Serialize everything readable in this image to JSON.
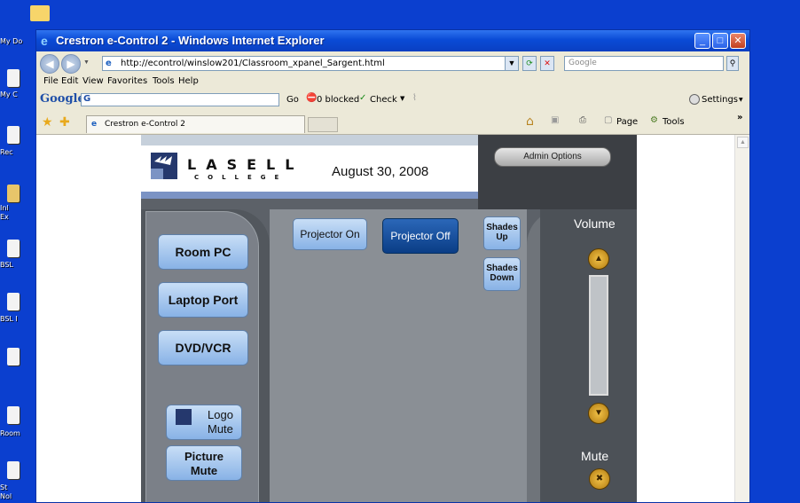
{
  "desktop": {
    "icons": [
      {
        "label": "My Do"
      },
      {
        "label": "My C"
      },
      {
        "label": "Rec"
      },
      {
        "label": "Inl"
      },
      {
        "label": "Ex"
      },
      {
        "label": "BSL"
      },
      {
        "label": "BSL I"
      },
      {
        "label": "Room"
      },
      {
        "label": "St"
      },
      {
        "label": "Nol"
      }
    ]
  },
  "window": {
    "title": "Crestron e-Control 2 - Windows Internet Explorer",
    "minimize_icon": "minimize-icon",
    "maximize_icon": "maximize-icon",
    "close_icon": "close-icon"
  },
  "address_bar": {
    "url": "http://econtrol/winslow201/Classroom_xpanel_Sargent.html",
    "search_placeholder": "Google"
  },
  "menu": {
    "items": [
      "File",
      "Edit",
      "View",
      "Favorites",
      "Tools",
      "Help"
    ]
  },
  "google_toolbar": {
    "logo": "Google",
    "g_btn": "G",
    "go_label": "Go",
    "blocked_label": "0 blocked",
    "check_label": "Check",
    "settings_label": "Settings"
  },
  "tabs": {
    "active_label": "Crestron e-Control 2",
    "page_label": "Page",
    "tools_label": "Tools"
  },
  "panel": {
    "logo_top": "LASELL",
    "logo_bottom": "COLLEGE",
    "date": "August 30, 2008",
    "admin_button": "Admin Options",
    "sources": [
      "Room PC",
      "Laptop Port",
      "DVD/VCR"
    ],
    "logo_mute_line1": "Logo",
    "logo_mute_line2": "Mute",
    "picture_mute_line1": "Picture",
    "picture_mute_line2": "Mute",
    "projector_on": "Projector On",
    "projector_off": "Projector Off",
    "shades_up_line1": "Shades",
    "shades_up_line2": "Up",
    "shades_down_line1": "Shades",
    "shades_down_line2": "Down",
    "volume_label": "Volume",
    "mute_label": "Mute"
  }
}
